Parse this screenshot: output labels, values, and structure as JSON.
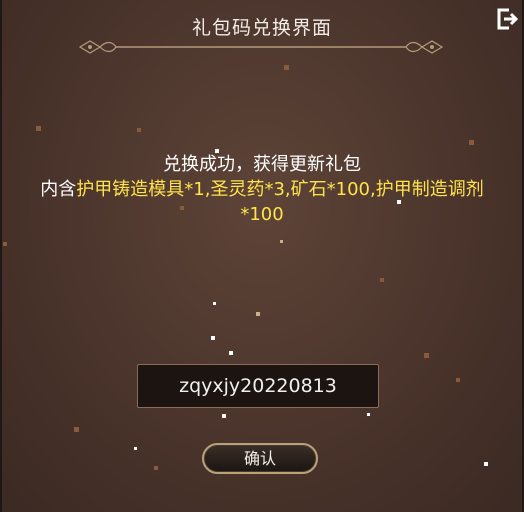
{
  "header": {
    "title": "礼包码兑换界面",
    "exit_icon": "exit-icon"
  },
  "message": {
    "line1": "兑换成功，获得更新礼包",
    "prefix": "内含",
    "rewards": "护甲铸造模具*1,圣灵药*3,矿石*100,护甲制造调剂*100"
  },
  "code_input": {
    "value": "zqyxjy20220813"
  },
  "confirm": {
    "label": "确认"
  },
  "colors": {
    "highlight": "#ffe34a",
    "text": "#ffffff",
    "button_border": "#b8a27a"
  }
}
